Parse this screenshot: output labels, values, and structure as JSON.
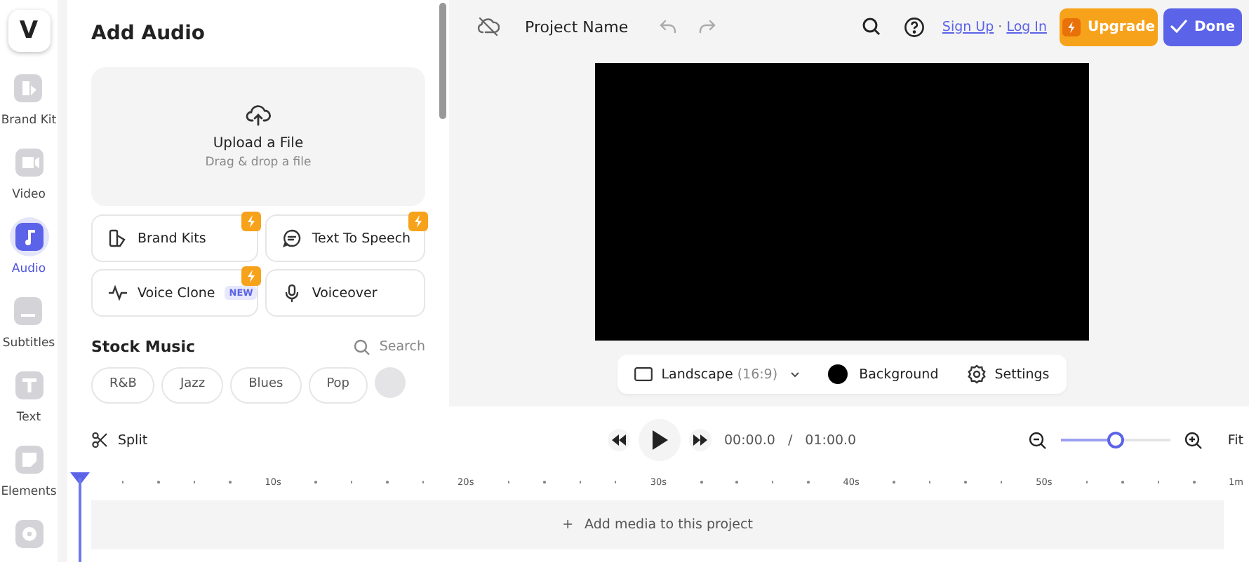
{
  "rail": {
    "logo": "V",
    "items": [
      {
        "kind": "brand",
        "label": "Brand Kit",
        "selected": false
      },
      {
        "kind": "video",
        "label": "Video",
        "selected": false
      },
      {
        "kind": "audio",
        "label": "Audio",
        "selected": true
      },
      {
        "kind": "subtitles",
        "label": "Subtitles",
        "selected": false
      },
      {
        "kind": "text",
        "label": "Text",
        "selected": false
      },
      {
        "kind": "elements",
        "label": "Elements",
        "selected": false
      }
    ]
  },
  "panel": {
    "title": "Add Audio",
    "upload": {
      "title": "Upload a File",
      "hint": "Drag & drop a file"
    },
    "tools": [
      {
        "kind": "brand",
        "label": "Brand Kits",
        "premium": true
      },
      {
        "kind": "speech",
        "label": "Text To Speech",
        "premium": true
      },
      {
        "kind": "clone",
        "label": "Voice Clone",
        "tag": "NEW",
        "premium": true
      },
      {
        "kind": "mic",
        "label": "Voiceover",
        "premium": false
      }
    ],
    "stock_music": {
      "title": "Stock Music",
      "search": "Search",
      "genres": [
        "R&B",
        "Jazz",
        "Blues",
        "Pop"
      ]
    }
  },
  "topbar": {
    "project_name": "Project Name",
    "sign_up": "Sign Up",
    "separator": "·",
    "log_in": "Log In",
    "upgrade": "Upgrade",
    "done": "Done"
  },
  "canvas_toolbar": {
    "orientation": "Landscape",
    "ratio": "(16:9)",
    "background": "Background",
    "settings": "Settings"
  },
  "timeline": {
    "split": "Split",
    "current_time": "00:00.0",
    "time_separator": "/",
    "duration": "01:00.0",
    "zoom": {
      "level": 0.5
    },
    "fit": "Fit",
    "ruler": [
      "10s",
      "20s",
      "30s",
      "40s",
      "50s",
      "1m"
    ],
    "add_media": {
      "icon": "+",
      "label": "Add media to this project"
    }
  }
}
